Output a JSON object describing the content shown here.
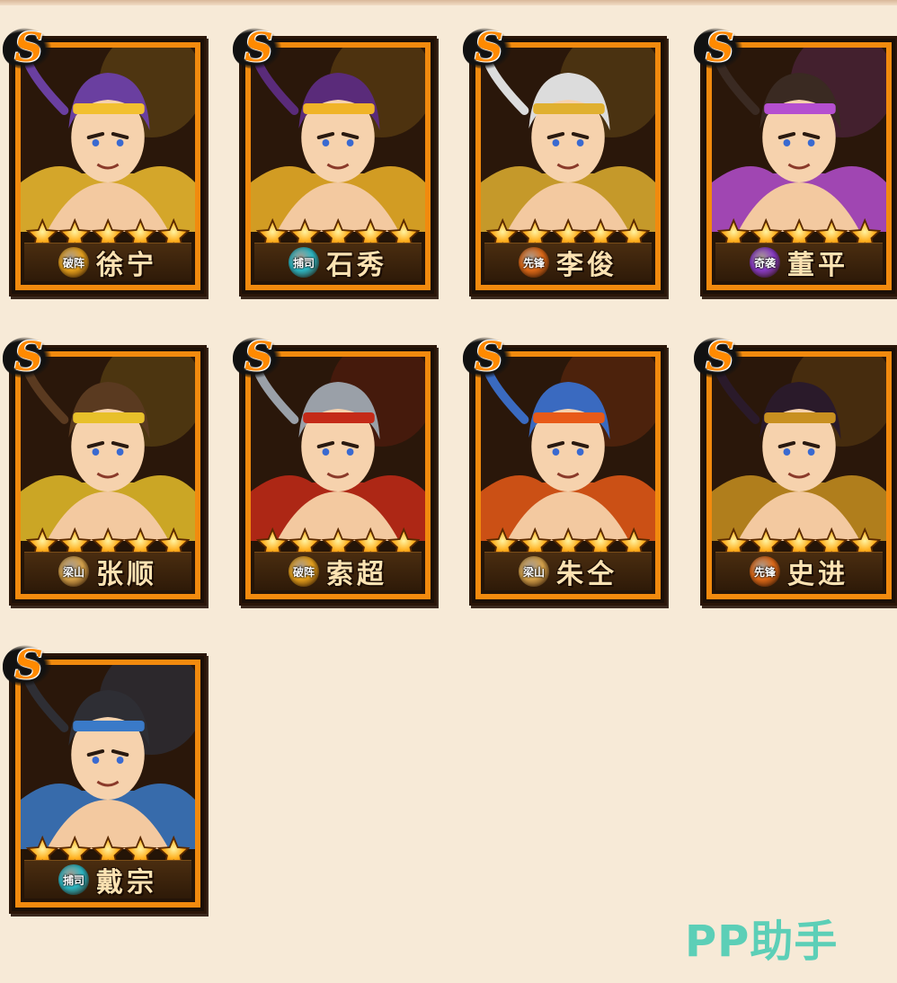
{
  "rank_letter": "S",
  "colors": {
    "background": "#f7ead7",
    "card_frame": "#f28a0e",
    "star": "#ffb020",
    "watermark": "#5ccfb7"
  },
  "heroes": [
    {
      "name": "徐宁",
      "stars": 5,
      "faction_label": "破阵",
      "faction_color": "#e8a21c",
      "hair": "#6a3fa0",
      "accent": "#f2c030"
    },
    {
      "name": "石秀",
      "stars": 5,
      "faction_label": "捕司",
      "faction_color": "#2bb9c6",
      "hair": "#5a2b7a",
      "accent": "#f0b428"
    },
    {
      "name": "李俊",
      "stars": 5,
      "faction_label": "先锋",
      "faction_color": "#e06a18",
      "hair": "#dcdcdc",
      "accent": "#e0b030"
    },
    {
      "name": "董平",
      "stars": 5,
      "faction_label": "奇袭",
      "faction_color": "#8a3cc8",
      "hair": "#3a2a22",
      "accent": "#b54fd0"
    },
    {
      "name": "张顺",
      "stars": 5,
      "faction_label": "梁山",
      "faction_color": "#d6a24a",
      "hair": "#5a3a20",
      "accent": "#e8c02a"
    },
    {
      "name": "索超",
      "stars": 5,
      "faction_label": "破阵",
      "faction_color": "#e8a21c",
      "hair": "#9aa0a8",
      "accent": "#c42a18"
    },
    {
      "name": "朱仝",
      "stars": 5,
      "faction_label": "梁山",
      "faction_color": "#d6a24a",
      "hair": "#3a6ac0",
      "accent": "#e85a18"
    },
    {
      "name": "史进",
      "stars": 5,
      "faction_label": "先锋",
      "faction_color": "#e06a18",
      "hair": "#2a1a2a",
      "accent": "#c89020"
    },
    {
      "name": "戴宗",
      "stars": 5,
      "faction_label": "捕司",
      "faction_color": "#2bb9c6",
      "hair": "#2e2e34",
      "accent": "#3a7ac8"
    }
  ],
  "watermark": "PP助手"
}
